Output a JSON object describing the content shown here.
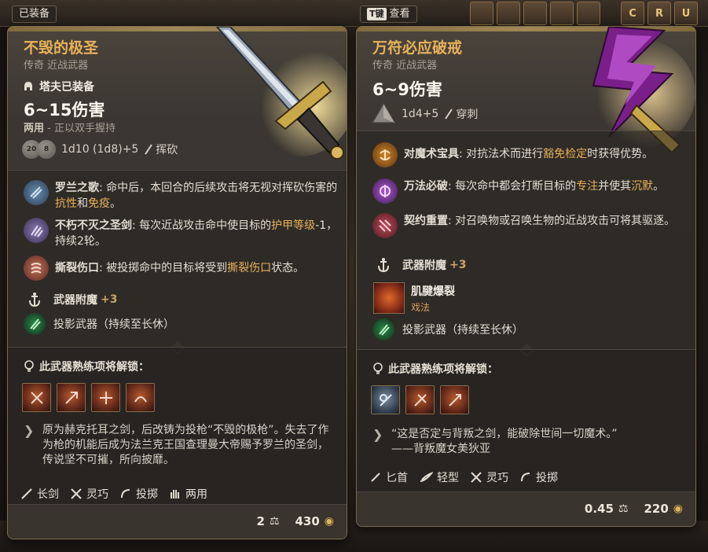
{
  "header": {
    "equipped_tag": "已装备",
    "compare_key": "T键",
    "compare_label": "查看",
    "topbar_slots": [
      "C",
      "R",
      "U"
    ]
  },
  "left_card": {
    "title": "不毁的极圣",
    "subtitle": "传奇 近战武器",
    "equipped_by": "塔夫已装备",
    "damage": "6~15伤害",
    "handedness": "两用",
    "handedness_note": " - 正以双手握持",
    "dice_labels": [
      "20",
      "8"
    ],
    "dice_formula": "1d10 (1d8)+5",
    "damage_type": "挥砍",
    "passives": [
      {
        "icon": "shield-slash-icon",
        "name": "罗兰之歌",
        "text": "命中后，本回合的后续攻击将无视对挥砍伤害的",
        "hl1": "抗性",
        "mid": "和",
        "hl2": "免疫",
        "end": "。"
      },
      {
        "icon": "claw-icon",
        "name": "不朽不灭之圣剑",
        "text": "每次近战攻击命中使目标的",
        "hl1": "护甲等级",
        "end": "-1，持续2轮。"
      },
      {
        "icon": "wound-icon",
        "name": "撕裂伤口",
        "text": "被投掷命中的目标将受到",
        "hl1": "撕裂伤口",
        "end": "状态。"
      }
    ],
    "enchant_label": "武器附魔",
    "enchant_value": "+3",
    "projection": "投影武器（持续至长休）",
    "unlock_title": "此武器熟练项将解锁：",
    "skills": [
      "skill-1",
      "skill-2",
      "skill-3",
      "skill-4"
    ],
    "lore": "原为赫克托耳之剑，后改铸为投枪“不毁的极枪”。失去了作为枪的机能后成为法兰克王国查理曼大帝赐予罗兰的圣剑，传说坚不可摧，所向披靡。",
    "properties": [
      {
        "icon": "longsword-icon",
        "label": "长剑"
      },
      {
        "icon": "finesse-icon",
        "label": "灵巧"
      },
      {
        "icon": "thrown-icon",
        "label": "投掷"
      },
      {
        "icon": "two-hands-icon",
        "label": "两用"
      }
    ],
    "weight": "2",
    "value": "430"
  },
  "right_card": {
    "title": "万符必应破戒",
    "subtitle": "传奇 近战武器",
    "damage": "6~9伤害",
    "dice_formula": "1d4+5",
    "damage_type": "穿刺",
    "passives": [
      {
        "icon": "rune-icon",
        "name": "对魔术宝具",
        "text": "对抗法术而进行",
        "hl1": "豁免检定",
        "end": "时获得优势。"
      },
      {
        "icon": "disrupt-icon",
        "name": "万法必破",
        "text": "每次命中都会打断目标的",
        "hl1": "专注",
        "mid": "并使其",
        "hl2": "沉默",
        "end": "。"
      },
      {
        "icon": "contract-icon",
        "name": "契约重置",
        "text": "对召唤物或召唤生物的近战攻击可将其驱逐。"
      }
    ],
    "enchant_label": "武器附魔",
    "enchant_value": "+3",
    "spell_name": "肌腱爆裂",
    "spell_kind": "戏法",
    "projection": "投影武器（持续至长休）",
    "unlock_title": "此武器熟练项将解锁：",
    "skills": [
      "skill-1",
      "skill-2",
      "skill-3"
    ],
    "lore": "“这是否定与背叛之剑，能破除世间一切魔术。”",
    "lore_author": "——背叛魔女美狄亚",
    "properties": [
      {
        "icon": "dagger-icon",
        "label": "匕首"
      },
      {
        "icon": "light-icon",
        "label": "轻型"
      },
      {
        "icon": "finesse-icon",
        "label": "灵巧"
      },
      {
        "icon": "thrown-icon",
        "label": "投掷"
      }
    ],
    "weight": "0.45",
    "value": "220"
  }
}
